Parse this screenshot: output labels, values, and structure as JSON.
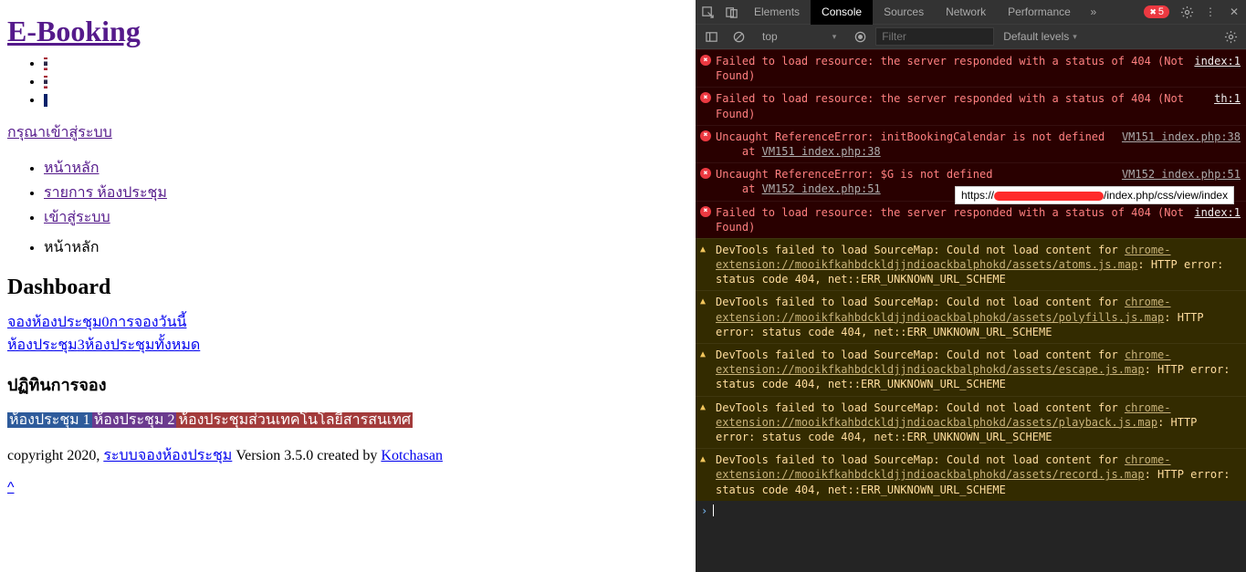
{
  "page": {
    "title": "E-Booking",
    "login_prompt": "กรุณาเข้าสู่ระบบ",
    "nav": {
      "home": "หน้าหลัก",
      "rooms": "รายการ ห้องประชุม",
      "login": "เข้าสู่ระบบ",
      "current": "หน้าหลัก"
    },
    "dashboard_heading": "Dashboard",
    "stats": {
      "line1_a": "จองห้องประชุม",
      "line1_b": "0",
      "line1_c": "การจองวันนี้",
      "line2_a": "ห้องประชุม",
      "line2_b": "3",
      "line2_c": "ห้องประชุมทั้งหมด"
    },
    "calendar_heading": "ปฏิทินการจอง",
    "room_labels": {
      "r1": "ห้องประชุม 1",
      "r2": "ห้องประชุม 2",
      "r3": "ห้องประชุมส่วนเทคโนโลยีสารสนเทศ"
    },
    "footer": {
      "pre": "copyright 2020, ",
      "link": "ระบบจองห้องประชุม",
      "mid": " Version 3.5.0 created by ",
      "author": "Kotchasan"
    },
    "caret": "^"
  },
  "devtools": {
    "tabs": [
      "Elements",
      "Console",
      "Sources",
      "Network",
      "Performance"
    ],
    "active_tab": "Console",
    "error_count": "5",
    "context": "top",
    "filter_placeholder": "Filter",
    "levels": "Default levels",
    "tooltip_prefix": "https://",
    "tooltip_suffix": "/index.php/css/view/index",
    "messages": [
      {
        "type": "error",
        "text": "Failed to load resource: the server responded with a status of 404 (Not Found)",
        "src": "index:1",
        "src_white": true
      },
      {
        "type": "error",
        "text": "Failed to load resource: the server responded with a status of 404 (Not Found)",
        "src": "th:1",
        "src_white": true
      },
      {
        "type": "error",
        "text": "Uncaught ReferenceError: initBookingCalendar is not defined",
        "sub": "    at ",
        "sublink": "VM151 index.php:38",
        "src": "VM151 index.php:38"
      },
      {
        "type": "error",
        "text": "Uncaught ReferenceError: $G is not defined",
        "sub": "    at ",
        "sublink": "VM152 index.php:51",
        "src": "VM152 index.php:51"
      },
      {
        "type": "error",
        "text": "Failed to load resource: the server responded with a status of 404 (Not Found)",
        "src": "index:1",
        "src_white": true
      },
      {
        "type": "warn",
        "text": "DevTools failed to load SourceMap: Could not load content for ",
        "sublink": "chrome-extension://mooikfkahbdckldjjndioackbalphokd/assets/atoms.js.map",
        "tail": ": HTTP error: status code 404, net::ERR_UNKNOWN_URL_SCHEME"
      },
      {
        "type": "warn",
        "text": "DevTools failed to load SourceMap: Could not load content for ",
        "sublink": "chrome-extension://mooikfkahbdckldjjndioackbalphokd/assets/polyfills.js.map",
        "tail": ": HTTP error: status code 404, net::ERR_UNKNOWN_URL_SCHEME"
      },
      {
        "type": "warn",
        "text": "DevTools failed to load SourceMap: Could not load content for ",
        "sublink": "chrome-extension://mooikfkahbdckldjjndioackbalphokd/assets/escape.js.map",
        "tail": ": HTTP error: status code 404, net::ERR_UNKNOWN_URL_SCHEME"
      },
      {
        "type": "warn",
        "text": "DevTools failed to load SourceMap: Could not load content for ",
        "sublink": "chrome-extension://mooikfkahbdckldjjndioackbalphokd/assets/playback.js.map",
        "tail": ": HTTP error: status code 404, net::ERR_UNKNOWN_URL_SCHEME"
      },
      {
        "type": "warn",
        "text": "DevTools failed to load SourceMap: Could not load content for ",
        "sublink": "chrome-extension://mooikfkahbdckldjjndioackbalphokd/assets/record.js.map",
        "tail": ": HTTP error: status code 404, net::ERR_UNKNOWN_URL_SCHEME"
      }
    ]
  }
}
